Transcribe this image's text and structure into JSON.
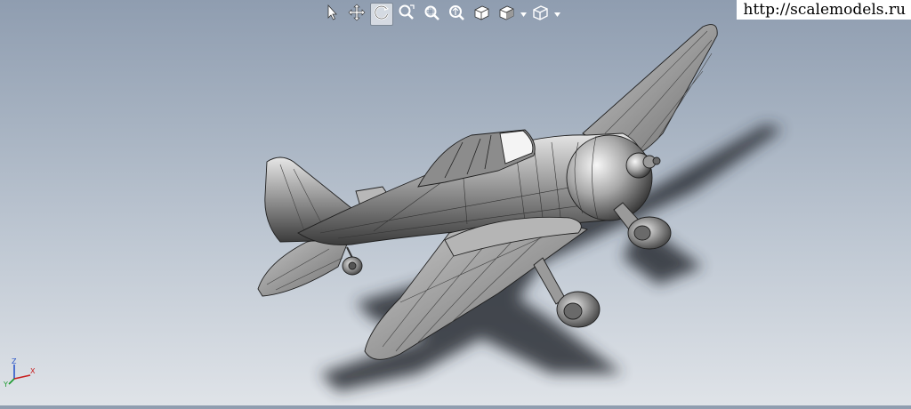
{
  "watermark": {
    "text": "http://scalemodels.ru"
  },
  "toolbar": {
    "buttons": [
      {
        "icon": "select-arrow-icon",
        "active": false
      },
      {
        "icon": "pan-icon",
        "active": false
      },
      {
        "icon": "rotate-icon",
        "active": true
      },
      {
        "icon": "zoom-to-fit-icon",
        "active": false
      },
      {
        "icon": "zoom-area-icon",
        "active": false
      },
      {
        "icon": "zoom-in-out-icon",
        "active": false
      },
      {
        "icon": "view-orientation-icon",
        "active": false
      },
      {
        "icon": "display-style-icon",
        "active": false,
        "has_dropdown": true
      },
      {
        "icon": "hide-show-items-icon",
        "active": false,
        "has_dropdown": true
      }
    ]
  },
  "triad": {
    "axes": [
      "X",
      "Y",
      "Z"
    ]
  },
  "colors": {
    "background_top": "#8f9db0",
    "background_bottom": "#dfe3e8",
    "model_gray": "#9a9a9a",
    "shadow": "#2a2f36",
    "toolbar_icon": "#ffffff",
    "active_button_bg": "#ebeef2"
  }
}
